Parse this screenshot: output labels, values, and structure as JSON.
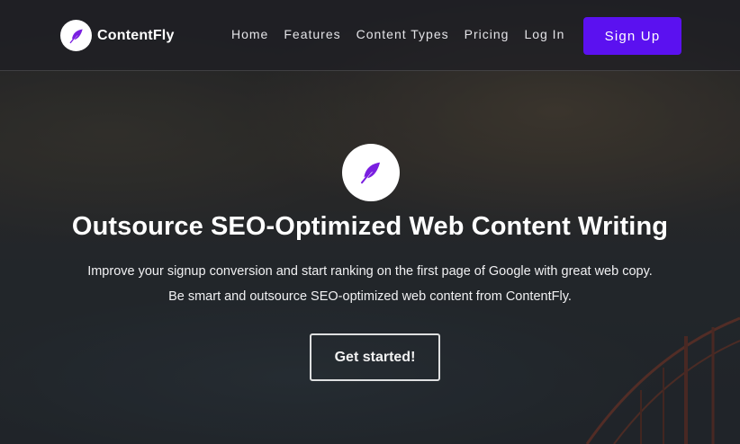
{
  "brand": {
    "name": "ContentFly",
    "logo_icon": "feather-icon"
  },
  "nav": {
    "links": [
      {
        "label": "Home"
      },
      {
        "label": "Features"
      },
      {
        "label": "Content Types"
      },
      {
        "label": "Pricing"
      },
      {
        "label": "Log In"
      }
    ],
    "signup_label": "Sign Up"
  },
  "hero": {
    "icon": "feather-icon",
    "title": "Outsource SEO-Optimized Web Content Writing",
    "subtitle_line1": "Improve your signup conversion and start ranking on the first page of Google with great web copy.",
    "subtitle_line2": "Be smart and outsource SEO-optimized web content from ContentFly.",
    "cta_label": "Get started!"
  },
  "colors": {
    "accent": "#5b11f0",
    "icon_purple": "#7a1fe0",
    "text": "#ffffff"
  }
}
